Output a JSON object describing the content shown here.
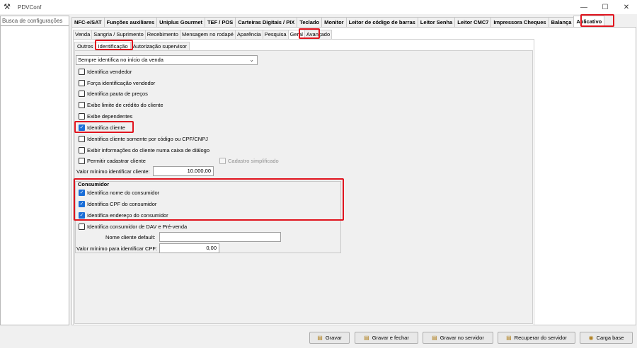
{
  "window": {
    "title": "PDVConf",
    "app_icon": "tools-icon",
    "controls": [
      "—",
      "☐",
      "✕"
    ]
  },
  "search": {
    "placeholder": "Busca de configurações"
  },
  "top_tabs": [
    {
      "label": "NFC-e/SAT",
      "w": 0
    },
    {
      "label": "Funções auxiliares"
    },
    {
      "label": "Uniplus Gourmet"
    },
    {
      "label": "TEF / POS"
    },
    {
      "label": "Carteiras Digitais / PIX"
    },
    {
      "label": "Teclado"
    },
    {
      "label": "Monitor"
    },
    {
      "label": "Leitor de código de barras"
    },
    {
      "label": "Leitor Senha"
    },
    {
      "label": "Leitor CMC7"
    },
    {
      "label": "Impressora Cheques"
    },
    {
      "label": "Balança"
    },
    {
      "label": "Aplicativo",
      "active": true
    }
  ],
  "sub_tabs": [
    {
      "label": "Venda"
    },
    {
      "label": "Sangria / Suprimento"
    },
    {
      "label": "Recebimento"
    },
    {
      "label": "Mensagem no rodapé"
    },
    {
      "label": "Aparência"
    },
    {
      "label": "Pesquisa"
    },
    {
      "label": "Geral",
      "active": true
    },
    {
      "label": "Avançado"
    }
  ],
  "sub2_tabs": [
    {
      "label": "Outros"
    },
    {
      "label": "Identificação",
      "active": true
    },
    {
      "label": "Autorização supervisor"
    }
  ],
  "dropdown": {
    "value": "Sempre identifica no início da venda"
  },
  "checkboxes": [
    {
      "label": "Identifica vendedor",
      "checked": false
    },
    {
      "label": "Força identificação vendedor",
      "checked": false
    },
    {
      "label": "Identifica pauta de preços",
      "checked": false
    },
    {
      "label": "Exibe limite de crédito do cliente",
      "checked": false
    },
    {
      "label": "Exibe dependentes",
      "checked": false
    },
    {
      "label": "Identifica cliente",
      "checked": true
    },
    {
      "label": "Identifica cliente somente por código ou CPF/CNPJ",
      "checked": false
    },
    {
      "label": "Exibir informações do cliente numa caixa de diálogo",
      "checked": false
    },
    {
      "label": "Permitir cadastrar cliente",
      "checked": false
    }
  ],
  "cadastro_simplificado": {
    "label": "Cadastro simplificado",
    "checked": false,
    "disabled": true
  },
  "valor_minimo_cliente": {
    "label": "Valor mínimo identificar cliente:",
    "value": "10.000,00"
  },
  "consumidor": {
    "title": "Consumidor",
    "checkboxes": [
      {
        "label": "Identifica nome do consumidor",
        "checked": true
      },
      {
        "label": "Identifica CPF do consumidor",
        "checked": true
      },
      {
        "label": "Identifica endereço do consumidor",
        "checked": true
      },
      {
        "label": "Identifica consumidor de DAV e Pré-venda",
        "checked": false
      }
    ],
    "nome_default": {
      "label": "Nome cliente default:",
      "value": ""
    },
    "valor_minimo_cpf": {
      "label": "Valor mínimo para identificar CPF:",
      "value": "0,00"
    }
  },
  "buttons": {
    "gravar": "Gravar",
    "gravar_fechar": "Gravar e fechar",
    "gravar_servidor": "Gravar no servidor",
    "recuperar_servidor": "Recuperar do servidor",
    "carga_base": "Carga base"
  },
  "colors": {
    "highlight": "#e0141e",
    "check": "#1a6ed8"
  }
}
